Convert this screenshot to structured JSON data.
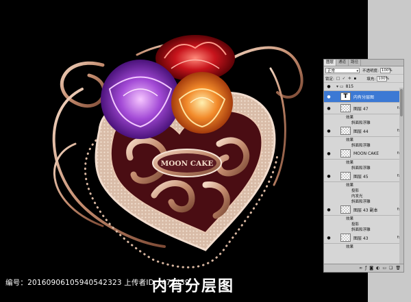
{
  "artwork": {
    "logo_text": "MOON CAKE"
  },
  "panel": {
    "tabs": [
      {
        "label": "图层",
        "active": true
      },
      {
        "label": "通道",
        "active": false
      },
      {
        "label": "路径",
        "active": false
      }
    ],
    "blend_mode": "正常",
    "opacity_label": "不透明度:",
    "opacity_value": "100%",
    "lock_label": "锁定:",
    "fill_label": "填充:",
    "fill_value": "100%",
    "group_name": "815",
    "layers": [
      {
        "name": "内有分层图",
        "type": "text",
        "selected": true
      },
      {
        "name": "图层 47",
        "effects": [
          "效果",
          "斜面和浮雕"
        ]
      },
      {
        "name": "图层 44",
        "effects": [
          "效果",
          "斜面和浮雕"
        ]
      },
      {
        "name": "MOON CAKE",
        "effects": [
          "效果",
          "斜面和浮雕"
        ]
      },
      {
        "name": "图层 45",
        "effects": [
          "效果",
          "投影",
          "内发光",
          "斜面和浮雕"
        ]
      },
      {
        "name": "图层 43 副本",
        "effects": [
          "效果",
          "投影",
          "斜面和浮雕"
        ]
      },
      {
        "name": "图层 43",
        "effects": [
          "效果"
        ]
      }
    ],
    "fx_label": "fx",
    "footer_icons": [
      "link-icon",
      "fx-icon",
      "mask-icon",
      "adjustment-icon",
      "folder-icon",
      "new-layer-icon",
      "trash-icon"
    ]
  },
  "watermark": {
    "id_text": "编号：20160906105940542323 上传者ID：471439",
    "caption": "内有分层图"
  },
  "colors": {
    "background": "#000000",
    "bronze": "#c89478",
    "maroon": "#4a0d13",
    "selected_layer": "#3c79d4"
  }
}
